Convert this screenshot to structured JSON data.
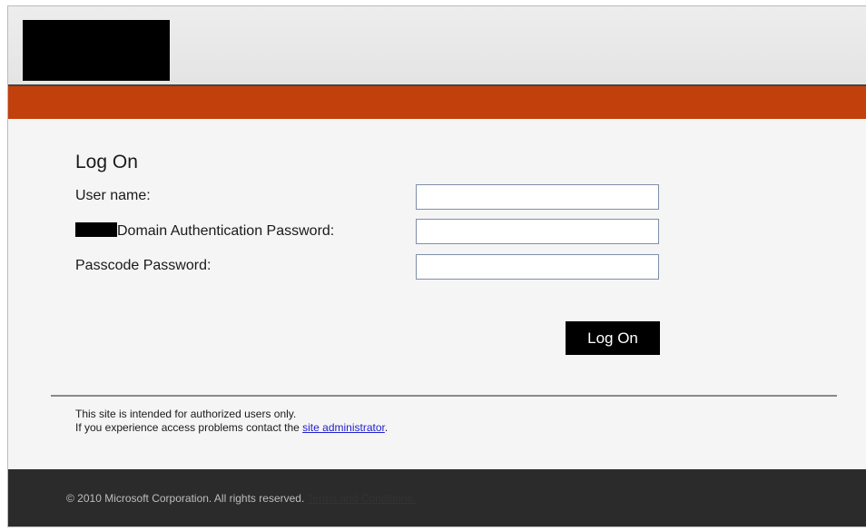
{
  "login": {
    "title": "Log On",
    "fields": {
      "username_label": "User name:",
      "domain_password_label": "Domain Authentication Password:",
      "passcode_label": "Passcode Password:",
      "username_value": "",
      "domain_password_value": "",
      "passcode_value": ""
    },
    "submit_label": "Log On"
  },
  "notice": {
    "line1": "This site is intended for authorized users only.",
    "line2_prefix": "If you experience access problems contact the ",
    "admin_link": "site administrator",
    "line2_suffix": "."
  },
  "footer": {
    "copyright": "© 2010 Microsoft Corporation. All rights reserved.",
    "terms_link": "Terms and Conditions."
  },
  "colors": {
    "accent_band": "#c2400b",
    "footer_bg": "#2b2b2b",
    "button_bg": "#000000",
    "link": "#2222cc"
  }
}
